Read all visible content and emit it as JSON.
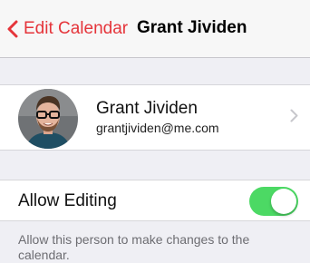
{
  "nav": {
    "back_label": "Edit Calendar",
    "title": "Grant Jividen",
    "accent_color": "#e5343a"
  },
  "contact": {
    "name": "Grant Jividen",
    "email": "grantjividen@me.com",
    "avatar_icon": "person-avatar",
    "disclosure_icon": "chevron-right-icon"
  },
  "allow_editing": {
    "label": "Allow Editing",
    "enabled": true,
    "on_color": "#4cd964",
    "description": "Allow this person to make changes to the calendar."
  }
}
